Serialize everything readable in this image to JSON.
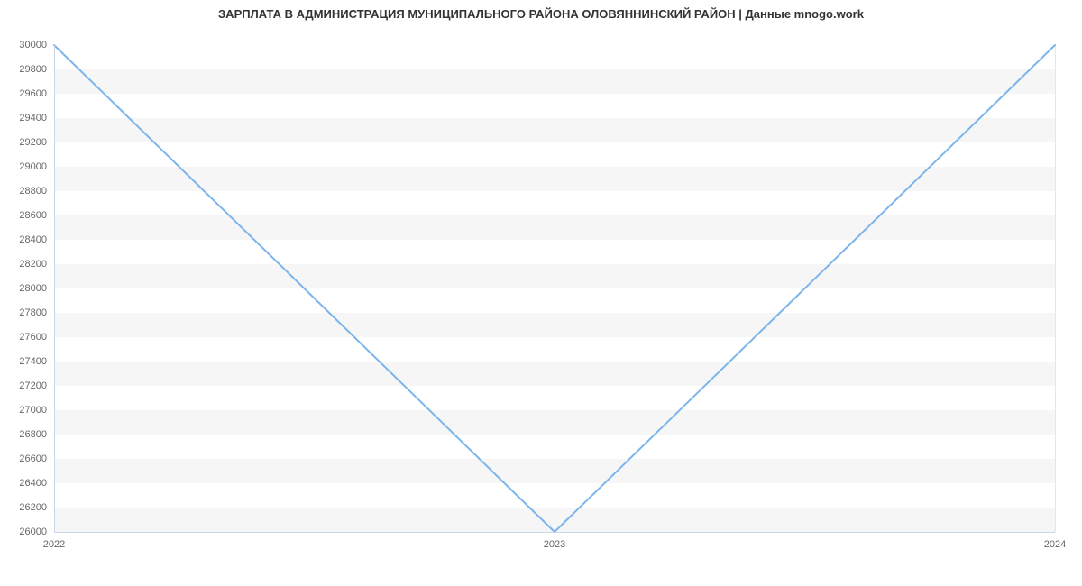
{
  "chart_data": {
    "type": "line",
    "title": "ЗАРПЛАТА В АДМИНИСТРАЦИЯ МУНИЦИПАЛЬНОГО РАЙОНА ОЛОВЯННИНСКИЙ РАЙОН | Данные mnogo.work",
    "xlabel": "",
    "ylabel": "",
    "x": [
      "2022",
      "2023",
      "2024"
    ],
    "y": [
      30000,
      26000,
      30000
    ],
    "x_ticks": [
      "2022",
      "2023",
      "2024"
    ],
    "y_ticks": [
      26000,
      26200,
      26400,
      26600,
      26800,
      27000,
      27200,
      27400,
      27600,
      27800,
      28000,
      28200,
      28400,
      28600,
      28800,
      29000,
      29200,
      29400,
      29600,
      29800,
      30000
    ],
    "ylim": [
      26000,
      30000
    ],
    "series_color": "#7cb5ec"
  }
}
